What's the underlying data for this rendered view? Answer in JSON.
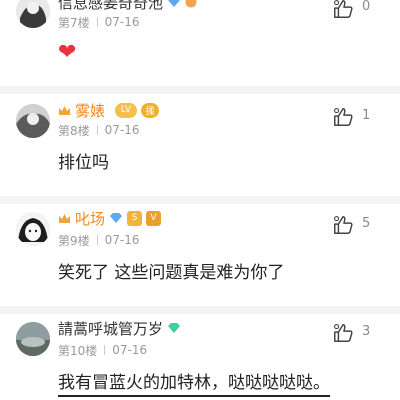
{
  "comments": [
    {
      "username": "信息感姜奇奇池",
      "floor": "第7楼",
      "date": "07-16",
      "content": "❤",
      "likes": "0"
    },
    {
      "username": "雾婊",
      "floor": "第8楼",
      "date": "07-16",
      "content": "排位吗",
      "likes": "1",
      "badge1": "LV",
      "badge2": "揉"
    },
    {
      "username": "叱场",
      "floor": "第9楼",
      "date": "07-16",
      "content": "笑死了 这些问题真是难为你了",
      "likes": "5",
      "badge1": "S",
      "badge2": "V"
    },
    {
      "username": "請蒿呼城管万岁",
      "floor": "第10楼",
      "date": "07-16",
      "content": "我有冒蓝火的加特林，哒哒哒哒哒。",
      "likes": "3"
    }
  ],
  "colors": {
    "vip_name": "#f28a1a",
    "heart": "#e8323c",
    "diamond_blue": "#5aa8f0",
    "diamond_green": "#3fcf9a"
  }
}
